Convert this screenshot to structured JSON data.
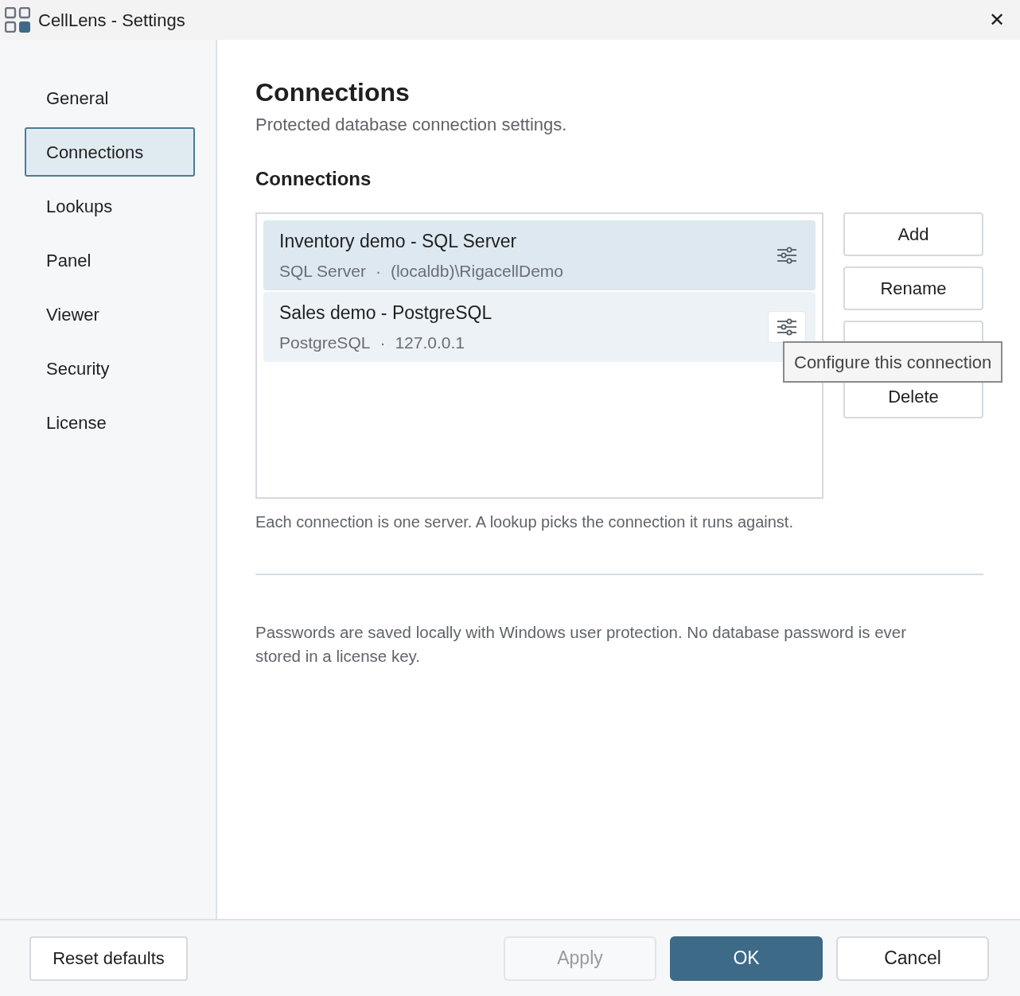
{
  "window": {
    "title": "CellLens - Settings",
    "close": "✕"
  },
  "sidebar": {
    "items": [
      {
        "label": "General",
        "selected": false
      },
      {
        "label": "Connections",
        "selected": true
      },
      {
        "label": "Lookups",
        "selected": false
      },
      {
        "label": "Panel",
        "selected": false
      },
      {
        "label": "Viewer",
        "selected": false
      },
      {
        "label": "Security",
        "selected": false
      },
      {
        "label": "License",
        "selected": false
      }
    ]
  },
  "page": {
    "title": "Connections",
    "subtitle": "Protected database connection settings.",
    "section": "Connections",
    "connections": [
      {
        "name": "Inventory demo - SQL Server",
        "type": "SQL Server",
        "separator": "·",
        "server": "(localdb)\\RigacellDemo",
        "selected": true,
        "hovered": false
      },
      {
        "name": "Sales demo - PostgreSQL",
        "type": "PostgreSQL",
        "separator": "·",
        "server": "127.0.0.1",
        "selected": false,
        "hovered": true
      }
    ],
    "actions": [
      {
        "label": "Add"
      },
      {
        "label": "Rename"
      },
      {
        "covered": true
      },
      {
        "label": "Delete"
      }
    ],
    "tooltip": "Configure this connection",
    "note": "Each connection is one server. A lookup picks the connection it runs against.",
    "security_note": "Passwords are saved locally with Windows user protection. No database password is ever stored in a license key."
  },
  "footer": {
    "reset": "Reset defaults",
    "buttons": [
      {
        "label": "Apply",
        "kind": "secondary",
        "disabled": true
      },
      {
        "label": "OK",
        "kind": "primary",
        "disabled": false
      },
      {
        "label": "Cancel",
        "kind": "secondary",
        "disabled": false
      }
    ]
  }
}
